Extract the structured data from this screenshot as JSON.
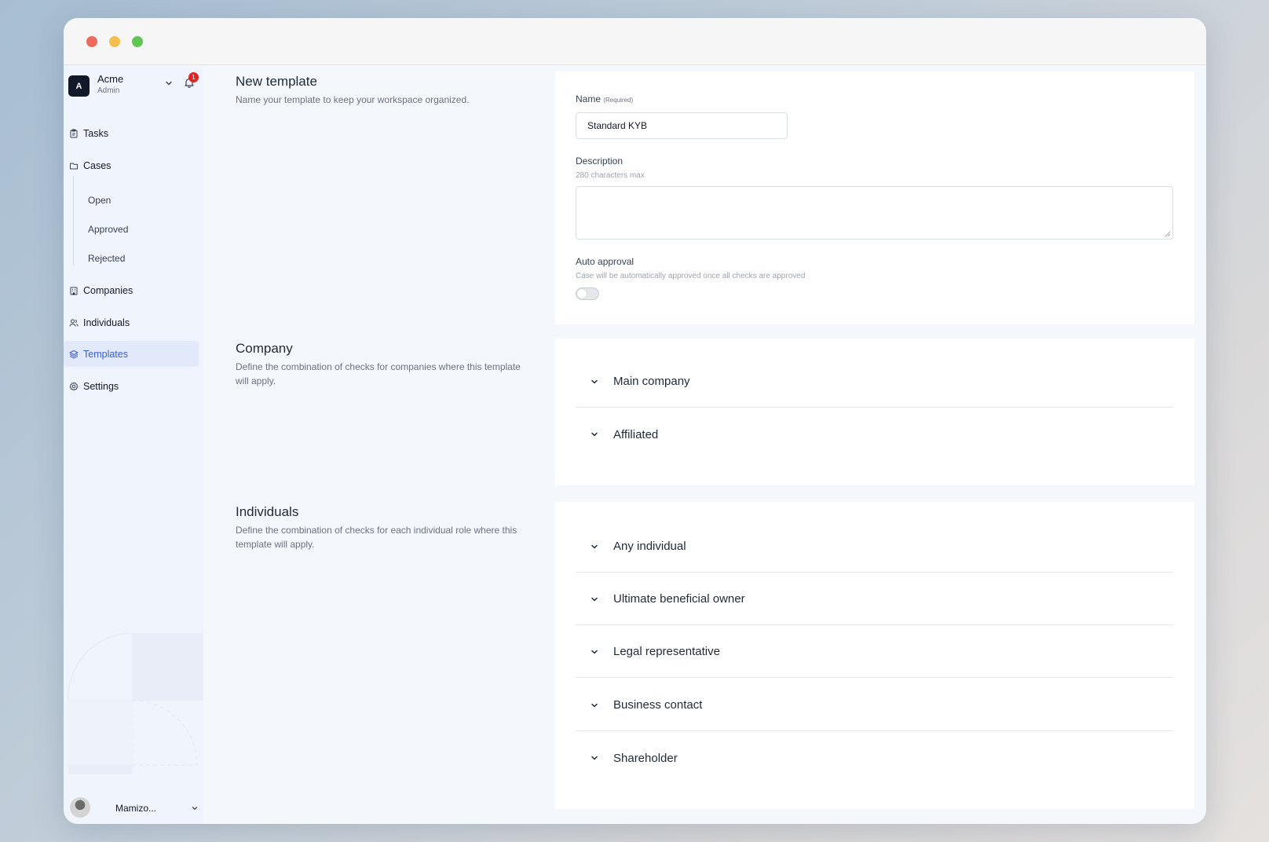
{
  "window": {
    "controls": [
      "close",
      "minimize",
      "zoom"
    ]
  },
  "workspace": {
    "avatar_letter": "A",
    "name": "Acme",
    "role": "Admin",
    "notification_count": "1"
  },
  "nav": {
    "tasks": "Tasks",
    "cases": "Cases",
    "cases_sub": {
      "open": "Open",
      "approved": "Approved",
      "rejected": "Rejected"
    },
    "companies": "Companies",
    "individuals": "Individuals",
    "templates": "Templates",
    "settings": "Settings",
    "active": "Templates"
  },
  "user": {
    "name": "Mamizo..."
  },
  "new_template": {
    "title": "New template",
    "description": "Name your template to keep your workspace organized.",
    "name_label": "Name",
    "name_required": "(Required)",
    "name_value": "Standard KYB",
    "description_label": "Description",
    "description_hint": "280 characters max",
    "description_value": "",
    "auto_approval_label": "Auto approval",
    "auto_approval_hint": "Case will be automatically approved once all checks are approved",
    "auto_approval_enabled": false
  },
  "company": {
    "title": "Company",
    "description": "Define the combination of checks for companies where this template will apply.",
    "sections": [
      "Main company",
      "Affiliated"
    ]
  },
  "individuals": {
    "title": "Individuals",
    "description": "Define the combination of checks for each individual role where this template will apply.",
    "sections": [
      "Any individual",
      "Ultimate beneficial owner",
      "Legal representative",
      "Business contact",
      "Shareholder"
    ]
  },
  "colors": {
    "accent": "#3b5fc9",
    "active_bg": "#e1e9fb",
    "sidebar_bg": "#f0f4fd",
    "main_bg": "#f4f7fb",
    "badge": "#dc2626"
  }
}
